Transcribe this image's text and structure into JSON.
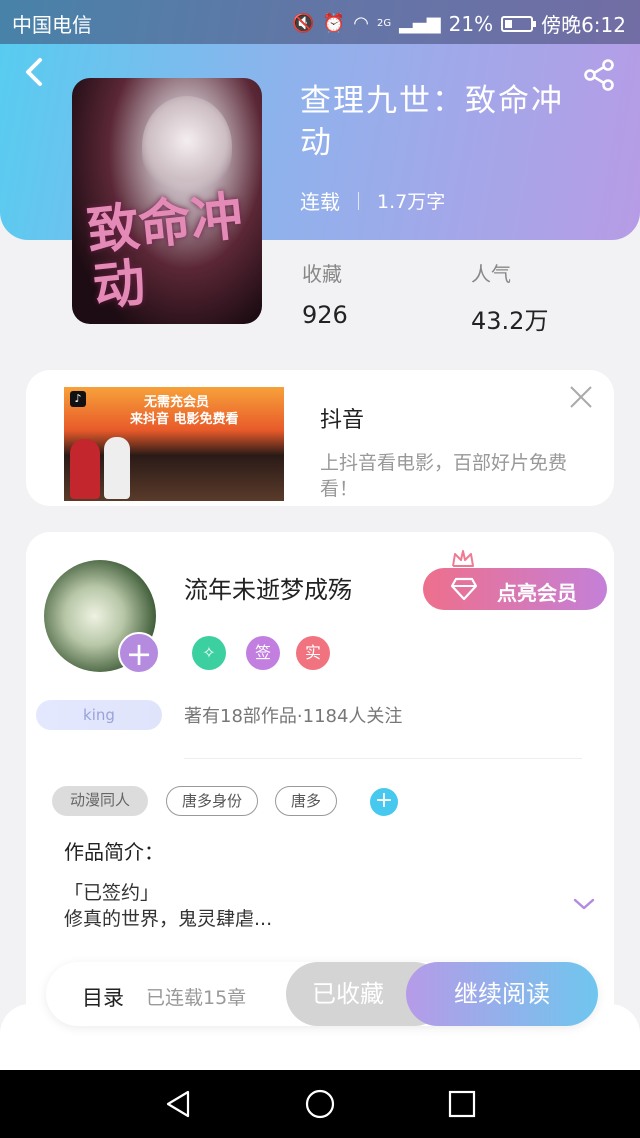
{
  "status_bar": {
    "carrier": "中国电信",
    "network": "2G",
    "battery": "21%",
    "time": "傍晚6:12"
  },
  "book": {
    "title": "查理九世：致命冲动",
    "cover_art_text": "致命冲动",
    "status": "连载",
    "word_count": "1.7万字",
    "favorites_label": "收藏",
    "favorites_value": "926",
    "popularity_label": "人气",
    "popularity_value": "43.2万"
  },
  "ad": {
    "image_line1": "无需充会员",
    "image_line2": "来抖音 电影免费看",
    "title": "抖音",
    "description": "上抖音看电影，百部好片免费看！"
  },
  "author": {
    "name": "流年未逝梦成殇",
    "vip_button": "点亮会员",
    "badge_sign": "签",
    "badge_real": "实",
    "level_tag": "king",
    "works_info": "著有18部作品·1184人关注"
  },
  "tags": [
    "动漫同人",
    "唐多身份",
    "唐多"
  ],
  "intro": {
    "heading": "作品简介：",
    "line1": "「已签约」",
    "line2": "修真的世界，鬼灵肆虐..."
  },
  "action_bar": {
    "toc": "目录",
    "chapters": "已连载15章",
    "favorited": "已收藏",
    "continue": "继续阅读"
  },
  "colors": {
    "header_gradient_start": "#56cdf0",
    "header_gradient_end": "#b79ce6",
    "vip_gradient_start": "#ee6f8c",
    "vip_gradient_end": "#c480d8",
    "read_gradient_start": "#b69be8",
    "read_gradient_end": "#6fc6ee"
  },
  "icons": [
    "back-arrow-icon",
    "share-icon",
    "close-icon",
    "diamond-icon",
    "crown-icon",
    "handshake-icon",
    "plus-icon",
    "chevron-down-icon",
    "nav-back-icon",
    "nav-home-icon",
    "nav-recents-icon"
  ]
}
